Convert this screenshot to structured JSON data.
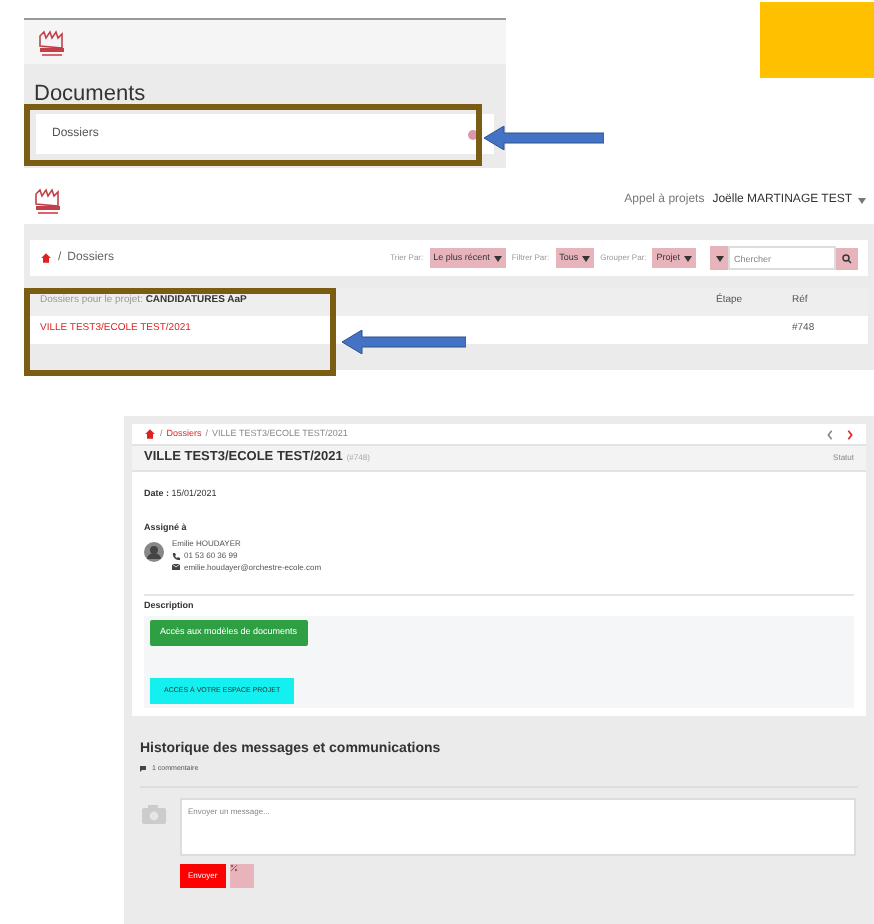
{
  "documents_panel": {
    "heading": "Documents",
    "items": [
      {
        "label": "Dossiers"
      }
    ]
  },
  "separator": "/",
  "list_panel": {
    "nav_link": "Appel à projets",
    "user": "Joëlle MARTINAGE TEST",
    "breadcrumb": "Dossiers",
    "filters": [
      {
        "label": "Trier Par:",
        "value": "Le plus récent"
      },
      {
        "label": "Filtrer Par:",
        "value": "Tous"
      },
      {
        "label": "Grouper Par:",
        "value": "Projet"
      }
    ],
    "search": {
      "placeholder": "Chercher"
    },
    "table": {
      "group_label": "Dossiers pour le projet:",
      "group_name": "CANDIDATURES AaP",
      "columns": [
        "Étape",
        "Réf"
      ],
      "rows": [
        {
          "name": "VILLE TEST3/ECOLE TEST/2021",
          "ref": "#748"
        }
      ]
    }
  },
  "detail_panel": {
    "breadcrumb": [
      "Dossiers",
      "VILLE TEST3/ECOLE TEST/2021"
    ],
    "title": "VILLE TEST3/ECOLE TEST/2021",
    "ref": "(#748)",
    "status": "Statut",
    "date_label": "Date :",
    "date": "15/01/2021",
    "assigned_label": "Assigné à",
    "person": {
      "name": "Emilie HOUDAYER",
      "phone": "01 53 60 36 99",
      "email": "emilie.houdayer@orchestre-ecole.com"
    },
    "description_label": "Description",
    "buttons": [
      {
        "label": "Accès aux modèles de documents",
        "kind": "green"
      },
      {
        "label": "ACCÈS À VOTRE ESPACE PROJET",
        "kind": "cyan"
      }
    ],
    "history_title": "Historique des messages et communications",
    "comment_count": "1 commentaire",
    "message": {
      "placeholder": "Envoyer un message..."
    },
    "send": "Envoyer"
  }
}
